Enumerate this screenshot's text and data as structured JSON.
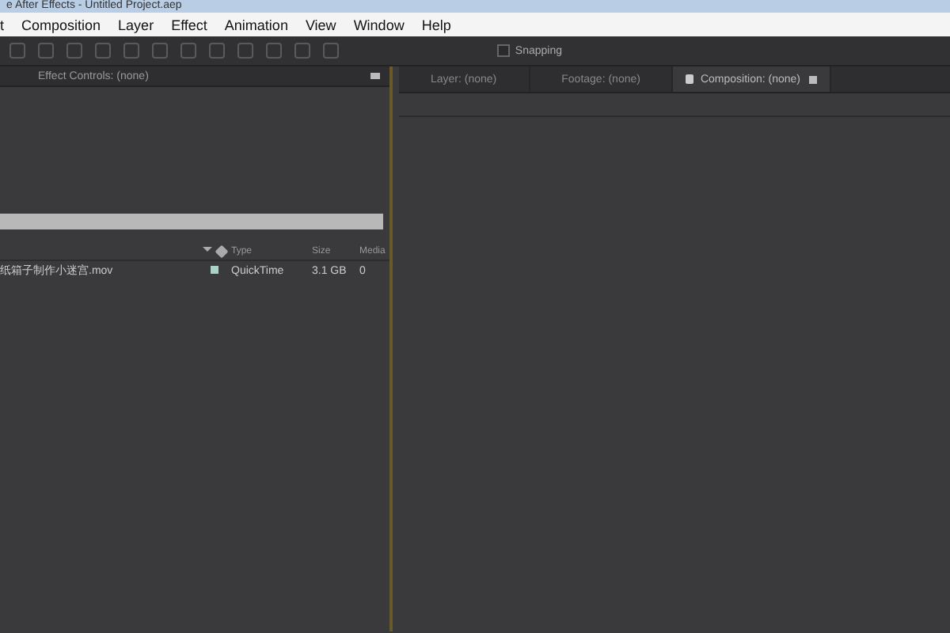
{
  "window": {
    "title": "e After Effects - Untitled Project.aep"
  },
  "menu": [
    "t",
    "Composition",
    "Layer",
    "Effect",
    "Animation",
    "View",
    "Window",
    "Help"
  ],
  "toolbar": {
    "snapping": {
      "label": "Snapping",
      "checked": false
    }
  },
  "left_panel": {
    "tab": "Effect Controls: (none)"
  },
  "project": {
    "columns": [
      "Type",
      "Size",
      "Media"
    ],
    "rows": [
      {
        "name": "纸箱子制作小迷宫.mov",
        "type": "QuickTime",
        "size": "3.1 GB",
        "media": "0"
      }
    ]
  },
  "right_panel": {
    "tabs": [
      {
        "label": "Layer: (none)",
        "selected": false
      },
      {
        "label": "Footage: (none)",
        "selected": false
      },
      {
        "label": "Composition: (none)",
        "selected": true
      }
    ]
  }
}
